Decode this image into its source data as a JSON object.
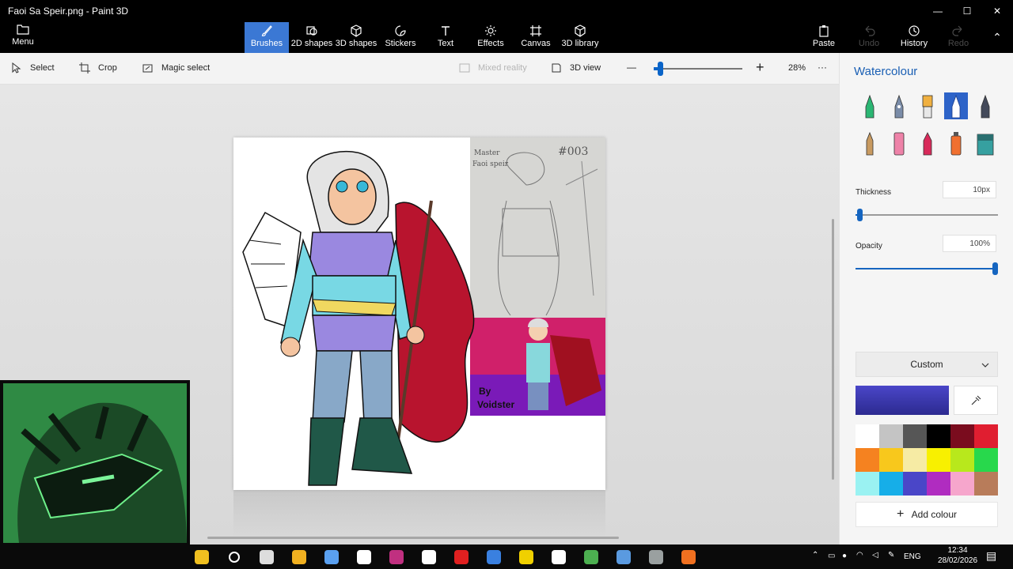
{
  "window": {
    "title": "Faoi Sa Speir.png - Paint 3D",
    "minimize": "—",
    "maximize": "☐",
    "close": "✕"
  },
  "menu": {
    "label": "Menu"
  },
  "ribbon": {
    "tabs": [
      {
        "label": "Brushes",
        "icon": "brush-icon",
        "active": true
      },
      {
        "label": "2D shapes",
        "icon": "2d-shapes-icon"
      },
      {
        "label": "3D shapes",
        "icon": "3d-shapes-icon"
      },
      {
        "label": "Stickers",
        "icon": "stickers-icon"
      },
      {
        "label": "Text",
        "icon": "text-icon"
      },
      {
        "label": "Effects",
        "icon": "effects-icon"
      },
      {
        "label": "Canvas",
        "icon": "canvas-icon"
      },
      {
        "label": "3D library",
        "icon": "3d-library-icon"
      }
    ],
    "actions": [
      {
        "label": "Paste",
        "icon": "paste-icon",
        "enabled": true
      },
      {
        "label": "Undo",
        "icon": "undo-icon",
        "enabled": false
      },
      {
        "label": "History",
        "icon": "history-icon",
        "enabled": true
      },
      {
        "label": "Redo",
        "icon": "redo-icon",
        "enabled": false
      }
    ],
    "collapse": "⌃"
  },
  "toolbar": {
    "select": "Select",
    "crop": "Crop",
    "magic_select": "Magic select",
    "mixed_reality": "Mixed reality",
    "view_3d": "3D view",
    "zoom_minus": "—",
    "zoom_plus": "+",
    "zoom_value": "28%",
    "more": "···",
    "zoom_fraction": 0.07
  },
  "artwork": {
    "sketch_caption_1": "Master",
    "sketch_caption_2": "Faoi speir",
    "sketch_caption_3": "#003",
    "signature_1": "By",
    "signature_2": "Voidster"
  },
  "panel": {
    "title": "Watercolour",
    "thickness_label": "Thickness",
    "thickness_value": "10px",
    "thickness_fraction": 0.03,
    "opacity_label": "Opacity",
    "opacity_value": "100%",
    "opacity_fraction": 1.0,
    "palette_mode": "Custom",
    "current_colour": "#4a46c8",
    "add_colour": "Add colour",
    "brushes": [
      {
        "name": "marker-brush-icon",
        "colour": "#2bb673"
      },
      {
        "name": "calligraphy-pen-brush-icon",
        "colour": "#7a8ca8"
      },
      {
        "name": "oil-brush-icon",
        "colour": "#f0b040"
      },
      {
        "name": "watercolour-brush-icon",
        "colour": "#ffffff"
      },
      {
        "name": "pixel-pen-brush-icon",
        "colour": "#444a5a"
      },
      {
        "name": "pencil-brush-icon",
        "colour": "#c89a60"
      },
      {
        "name": "eraser-brush-icon",
        "colour": "#ee82a8"
      },
      {
        "name": "crayon-brush-icon",
        "colour": "#d82a5a"
      },
      {
        "name": "spray-can-brush-icon",
        "colour": "#f07030"
      },
      {
        "name": "fill-bucket-icon",
        "colour": "#36a0a0"
      }
    ],
    "swatches": [
      "#ffffff",
      "#c4c4c4",
      "#565656",
      "#000000",
      "#7a0c1e",
      "#e01e30",
      "#f58220",
      "#f8c81c",
      "#f6eba4",
      "#f8f000",
      "#b8e81c",
      "#28d84c",
      "#9af2f2",
      "#16aee8",
      "#4a46c8",
      "#b02cc0",
      "#f6a6cc",
      "#b87c5a"
    ]
  },
  "taskbar": {
    "language": "ENG",
    "time": "12:34",
    "date": "28/02/2026",
    "apps": [
      "copilot-icon",
      "search-circle-icon",
      "task-view-icon",
      "file-explorer-icon",
      "paint-icon",
      "app-icon",
      "photoshop-icon",
      "media-player-icon",
      "youtube-icon",
      "paint-3d-icon",
      "sticky-notes-icon",
      "screenshot-icon",
      "chrome-icon",
      "notepad-icon",
      "app-icon-2",
      "app-icon-3"
    ]
  }
}
